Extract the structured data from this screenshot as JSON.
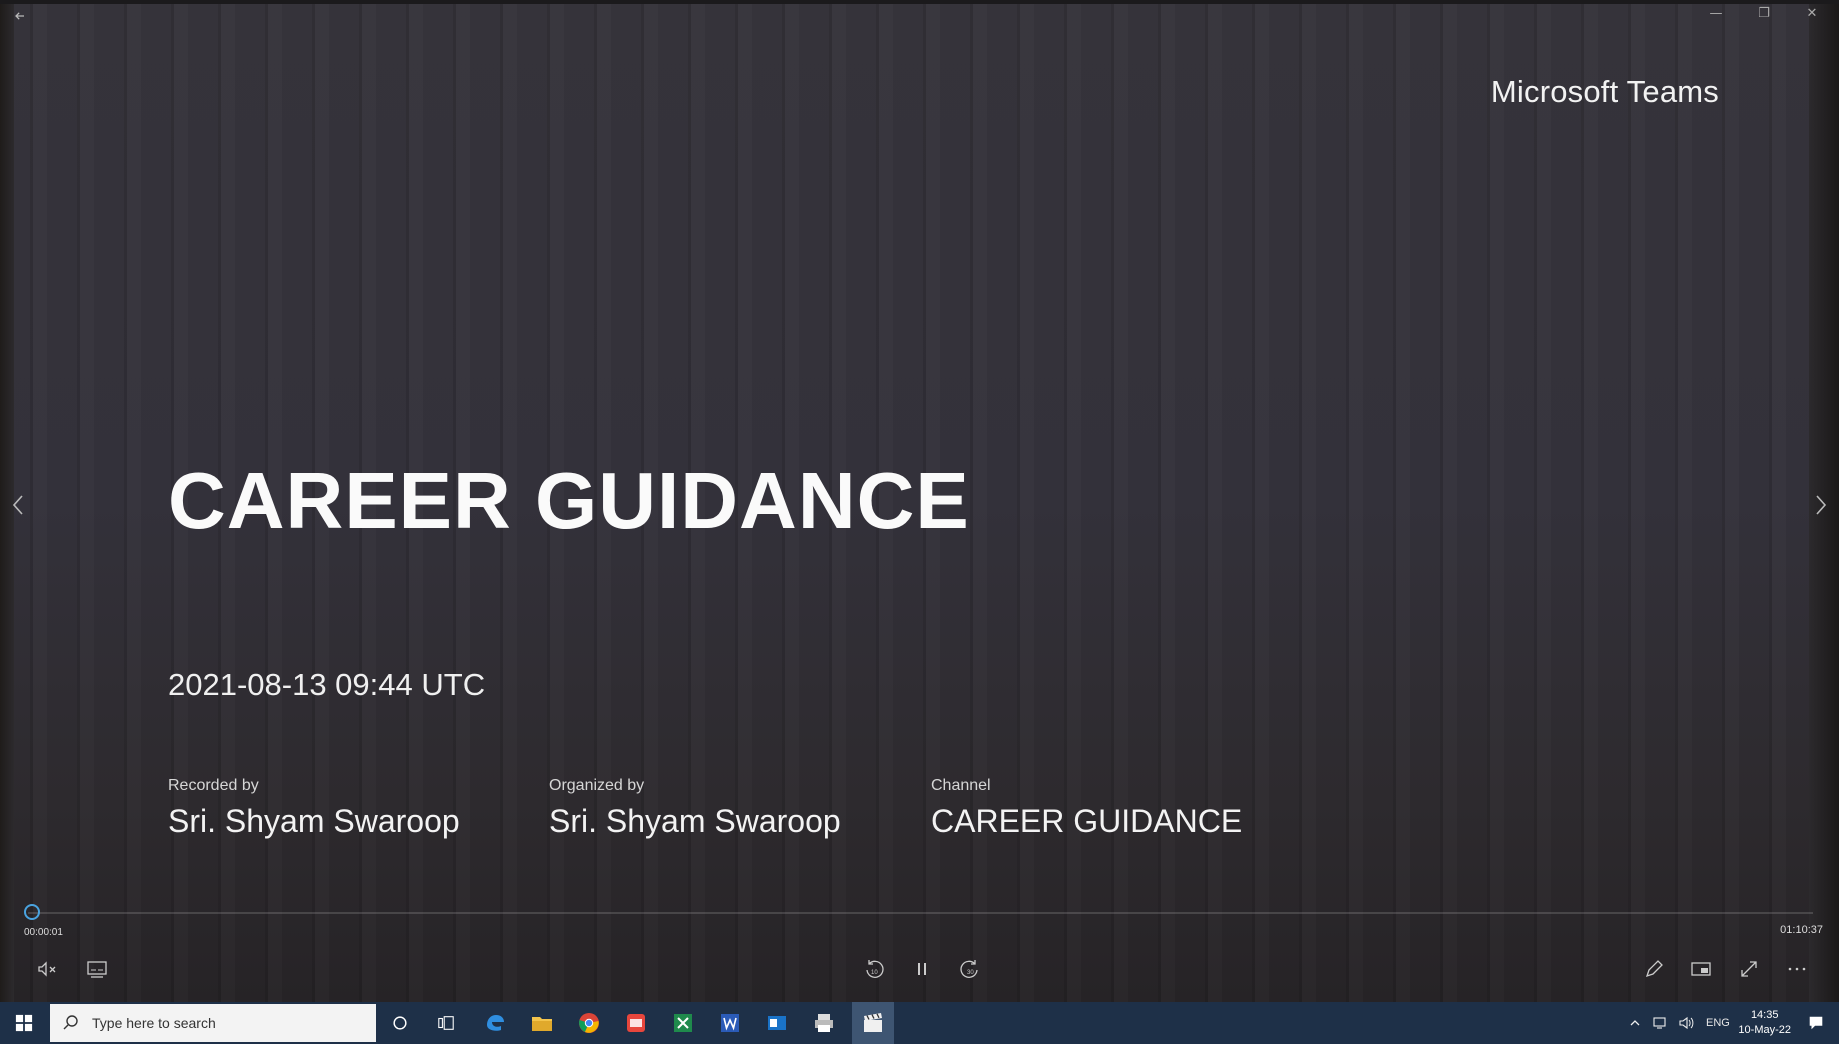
{
  "window": {
    "back_icon": "arrow-left-icon",
    "controls": [
      "minimize-icon",
      "restore-icon",
      "close-icon"
    ]
  },
  "slide": {
    "brand": "Microsoft Teams",
    "title": "CAREER GUIDANCE",
    "datetime": "2021-08-13 09:44 UTC",
    "recorded_by_label": "Recorded by",
    "recorded_by": "Sri. Shyam Swaroop",
    "organized_by_label": "Organized by",
    "organized_by": "Sri. Shyam Swaroop",
    "channel_label": "Channel",
    "channel": "CAREER GUIDANCE"
  },
  "player": {
    "elapsed": "00:00:01",
    "total": "01:10:37",
    "progress_fraction": 0.0002,
    "accent": "#4aa3e0",
    "left_controls": [
      "mute-icon",
      "captions-icon"
    ],
    "center_controls": [
      "rewind-10-icon",
      "pause-icon",
      "forward-30-icon"
    ],
    "right_controls": [
      "pen-icon",
      "picture-in-picture-icon",
      "fullscreen-icon",
      "more-icon"
    ]
  },
  "taskbar": {
    "search_placeholder": "Type here to search",
    "language": "ENG",
    "time": "14:35",
    "date": "10-May-22",
    "background": "#1e3048"
  }
}
